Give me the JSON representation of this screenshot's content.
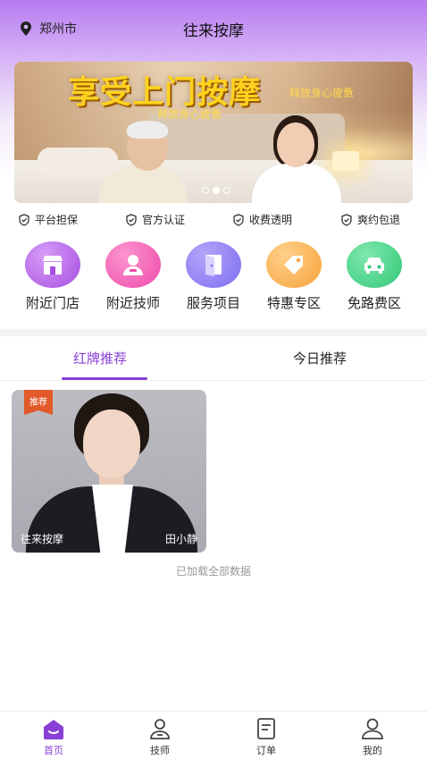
{
  "header": {
    "location": "郑州市",
    "title": "往来按摩"
  },
  "banner": {
    "title": "享受上门按摩",
    "subtitle_left": "释放身心疲惫",
    "subtitle_right": "释放身心疲惫",
    "slide_count": 3,
    "active_slide": 2
  },
  "guarantees": [
    {
      "label": "平台担保",
      "icon": "shield-check-icon"
    },
    {
      "label": "官方认证",
      "icon": "shield-check-icon"
    },
    {
      "label": "收费透明",
      "icon": "shield-check-icon"
    },
    {
      "label": "爽约包退",
      "icon": "shield-check-icon"
    }
  ],
  "categories": [
    {
      "label": "附近门店",
      "icon": "store-icon",
      "color": "#a64fe0"
    },
    {
      "label": "附近技师",
      "icon": "technician-icon",
      "color": "#ee4aa9"
    },
    {
      "label": "服务项目",
      "icon": "door-icon",
      "color": "#7d6cf0"
    },
    {
      "label": "特惠专区",
      "icon": "tag-icon",
      "color": "#f7a23a"
    },
    {
      "label": "免路费区",
      "icon": "car-icon",
      "color": "#33c978"
    }
  ],
  "tabs": {
    "active": "红牌推荐",
    "inactive": "今日推荐"
  },
  "card": {
    "badge": "推荐",
    "shop_name": "往来按摩",
    "therapist_name": "田小静"
  },
  "list_status": "已加载全部数据",
  "bottom_nav": [
    {
      "label": "首页",
      "icon": "home-icon",
      "active": true
    },
    {
      "label": "技师",
      "icon": "technician-icon",
      "active": false
    },
    {
      "label": "订单",
      "icon": "order-icon",
      "active": false
    },
    {
      "label": "我的",
      "icon": "profile-icon",
      "active": false
    }
  ],
  "colors": {
    "accent": "#8a3fd6",
    "header_gradient_top": "#b67bf0",
    "badge": "#e25a2a"
  }
}
